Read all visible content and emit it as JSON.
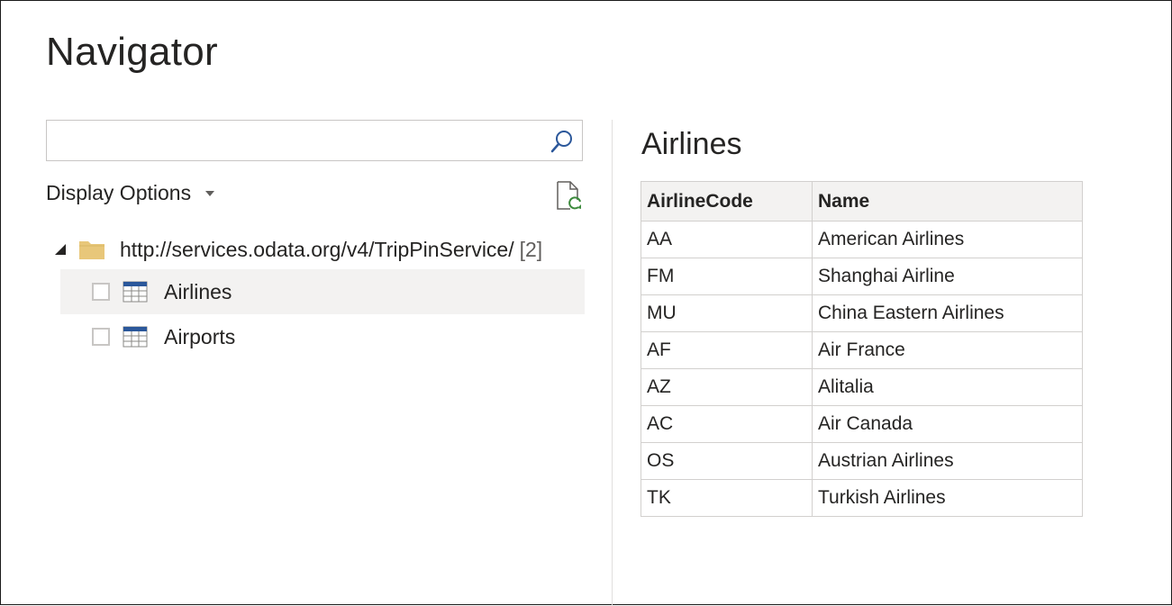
{
  "window": {
    "title": "Navigator"
  },
  "search": {
    "placeholder": "",
    "value": ""
  },
  "display_options": {
    "label": "Display Options"
  },
  "tree": {
    "root": {
      "label": "http://services.odata.org/v4/TripPinService/",
      "count": "[2]"
    },
    "items": [
      {
        "label": "Airlines",
        "selected": true,
        "checked": false
      },
      {
        "label": "Airports",
        "selected": false,
        "checked": false
      }
    ]
  },
  "preview": {
    "title": "Airlines",
    "columns": [
      "AirlineCode",
      "Name"
    ],
    "rows": [
      [
        "AA",
        "American Airlines"
      ],
      [
        "FM",
        "Shanghai Airline"
      ],
      [
        "MU",
        "China Eastern Airlines"
      ],
      [
        "AF",
        "Air France"
      ],
      [
        "AZ",
        "Alitalia"
      ],
      [
        "AC",
        "Air Canada"
      ],
      [
        "OS",
        "Austrian Airlines"
      ],
      [
        "TK",
        "Turkish Airlines"
      ]
    ]
  },
  "colors": {
    "accent": "#2b579a",
    "folder": "#e8c77a",
    "refresh": "#3c8a3c"
  },
  "icons": [
    "search-icon",
    "caret-down-icon",
    "refresh-icon",
    "expander-icon",
    "folder-icon",
    "table-icon"
  ]
}
